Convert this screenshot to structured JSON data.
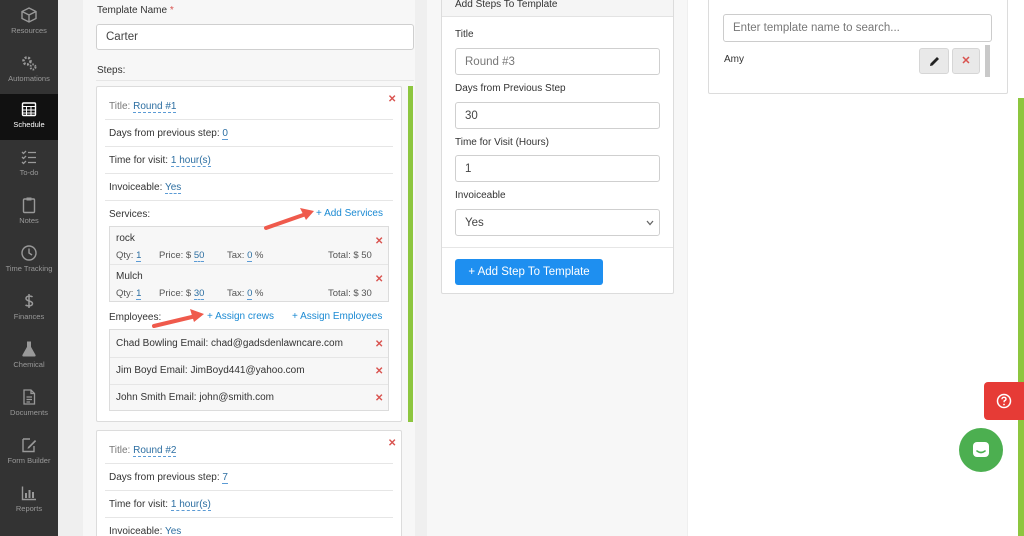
{
  "sidebar": {
    "items": [
      {
        "label": "Resources",
        "icon": "cube-icon"
      },
      {
        "label": "Automations",
        "icon": "gears-icon"
      },
      {
        "label": "Schedule",
        "icon": "calendar-icon"
      },
      {
        "label": "To-do",
        "icon": "checklist-icon"
      },
      {
        "label": "Notes",
        "icon": "clipboard-icon"
      },
      {
        "label": "Time Tracking",
        "icon": "clock-icon"
      },
      {
        "label": "Finances",
        "icon": "dollar-icon"
      },
      {
        "label": "Chemical",
        "icon": "flask-icon"
      },
      {
        "label": "Documents",
        "icon": "document-icon"
      },
      {
        "label": "Form Builder",
        "icon": "form-edit-icon"
      },
      {
        "label": "Reports",
        "icon": "bar-chart-icon"
      }
    ],
    "active": "Schedule"
  },
  "template_form": {
    "name_label": "Template Name",
    "required_mark": "*",
    "name_value": "Carter",
    "steps_label": "Steps:"
  },
  "step1": {
    "title_label": "Title:",
    "title_value": "Round #1",
    "days_label": "Days from previous step:",
    "days_value": "0",
    "time_label": "Time for visit:",
    "time_value": "1 hour(s)",
    "invoiceable_label": "Invoiceable:",
    "invoiceable_value": "Yes",
    "services_label": "Services:",
    "add_services": "+ Add Services",
    "services": [
      {
        "name": "rock",
        "qty_label": "Qty:",
        "qty": "1",
        "price_label": "Price: $",
        "price": "50",
        "tax_label": "Tax:",
        "tax": "0",
        "tax_unit": "%",
        "total": "Total: $ 50"
      },
      {
        "name": "Mulch",
        "qty_label": "Qty:",
        "qty": "1",
        "price_label": "Price: $",
        "price": "30",
        "tax_label": "Tax:",
        "tax": "0",
        "tax_unit": "%",
        "total": "Total: $ 30"
      }
    ],
    "employees_label": "Employees:",
    "assign_crews": "+ Assign crews",
    "assign_employees": "+ Assign Employees",
    "employees": [
      "Chad Bowling Email: chad@gadsdenlawncare.com",
      "Jim Boyd Email: JimBoyd441@yahoo.com",
      "John Smith Email: john@smith.com"
    ]
  },
  "step2": {
    "title_label": "Title:",
    "title_value": "Round #2",
    "days_label": "Days from previous step:",
    "days_value": "7",
    "time_label": "Time for visit:",
    "time_value": "1 hour(s)",
    "invoiceable_label": "Invoiceable:",
    "invoiceable_value": "Yes"
  },
  "add_steps": {
    "header": "Add Steps To Template",
    "title_label": "Title",
    "title_placeholder": "Round #3",
    "days_label": "Days from Previous Step",
    "days_value": "30",
    "time_label": "Time for Visit (Hours)",
    "time_value": "1",
    "invoiceable_label": "Invoiceable",
    "invoiceable_value": "Yes",
    "button": "+ Add Step To Template"
  },
  "search": {
    "placeholder": "Enter template name to search...",
    "results": [
      {
        "name": "Amy"
      }
    ]
  },
  "colors": {
    "sidebar_bg": "#333333",
    "primary": "#1e8ff0",
    "danger": "#d9534f",
    "success": "#8dc63f",
    "chat": "#4caf50"
  }
}
